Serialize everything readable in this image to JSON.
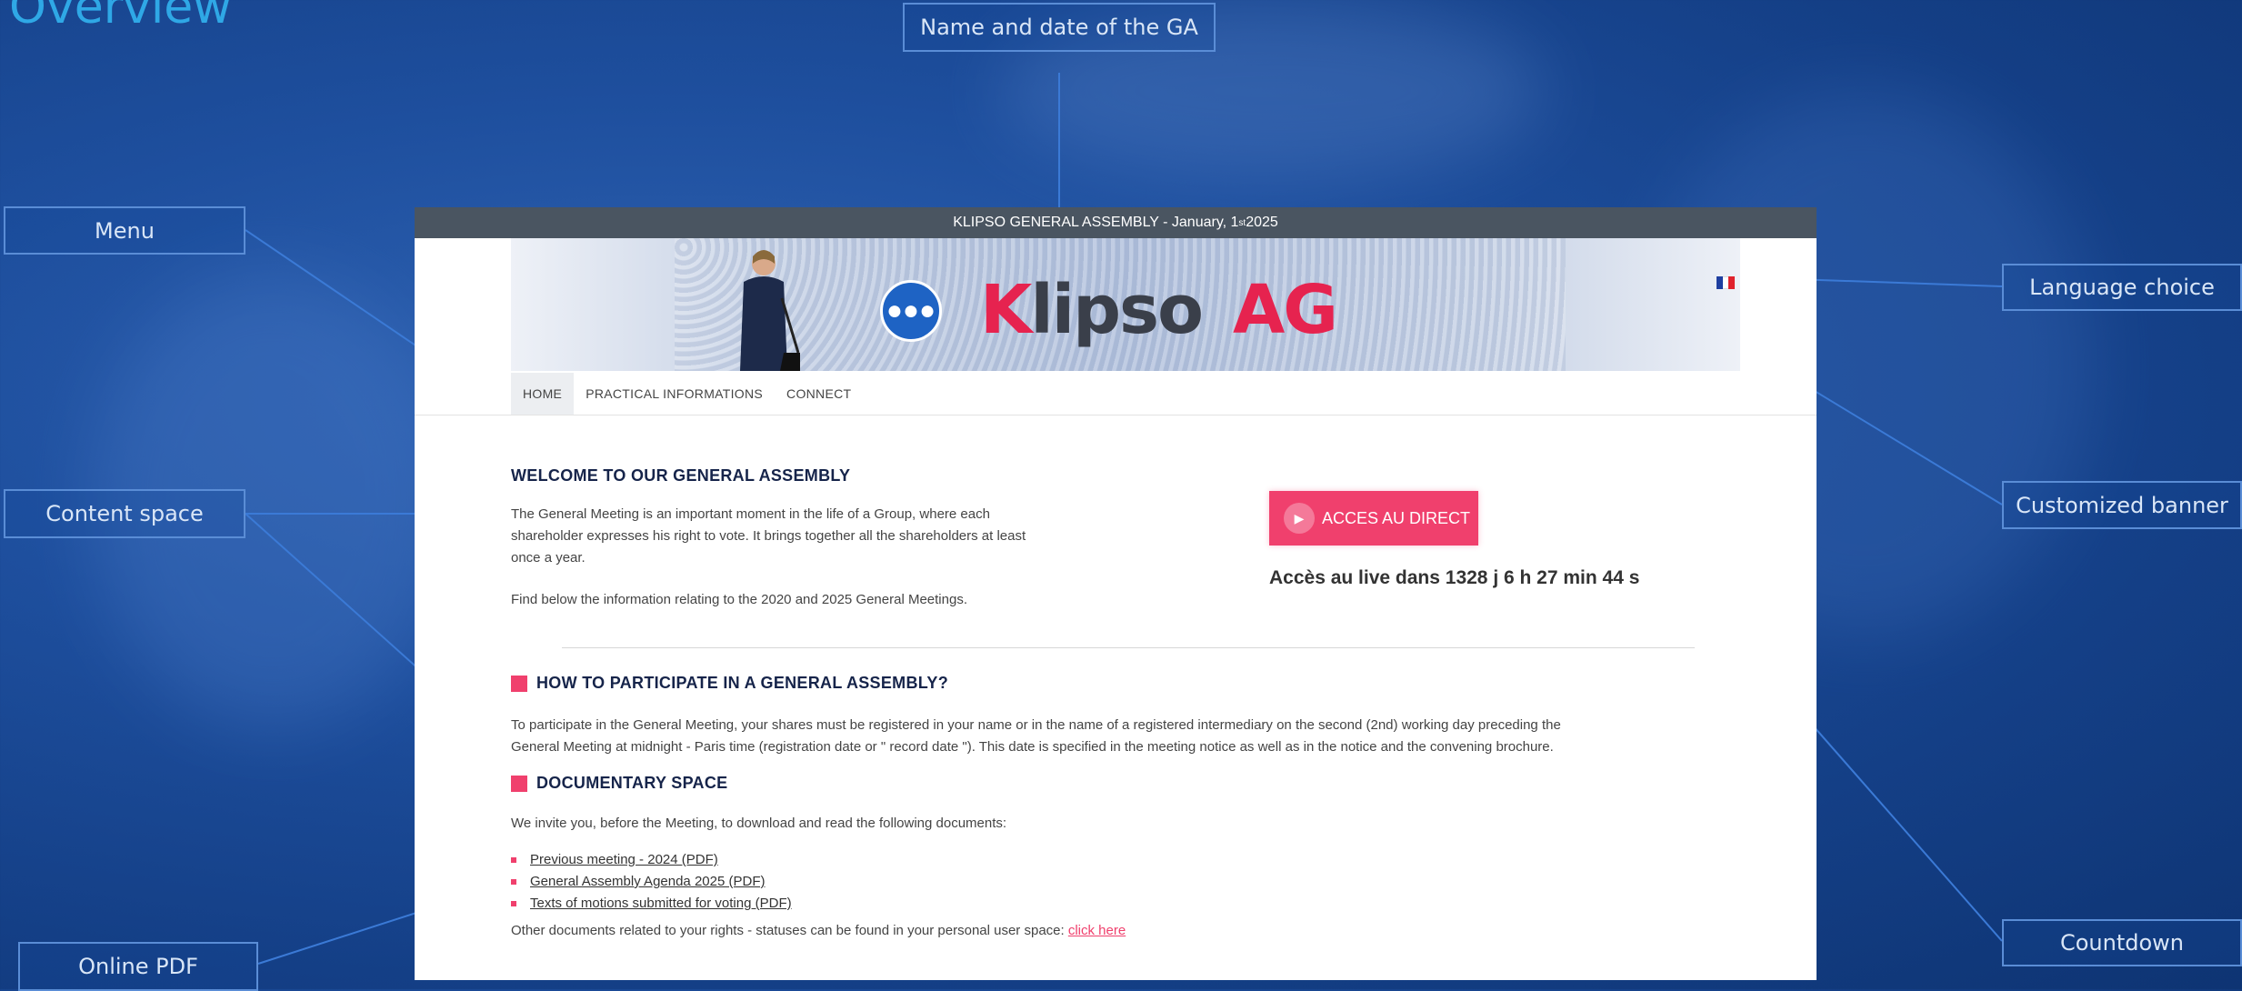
{
  "slide": {
    "title": "Overview"
  },
  "callouts": {
    "ga_name": "Name and date of the GA",
    "menu": "Menu",
    "content_space": "Content space",
    "online_pdf": "Online PDF",
    "language_choice": "Language choice",
    "customized_banner": "Customized banner",
    "countdown": "Countdown"
  },
  "mockup": {
    "topbar": {
      "title_main": "KLIPSO GENERAL ASSEMBLY - January, 1",
      "title_sup": "st",
      "title_end": " 2025"
    },
    "banner": {
      "logo_k": "K",
      "logo_rest": "lipso",
      "logo_ag": "AG",
      "logo_icon": "group-icon"
    },
    "language": {
      "flag": "france-flag-icon",
      "colors": [
        "#1f3fa0",
        "#ffffff",
        "#e0232d"
      ]
    },
    "nav": {
      "items": [
        "HOME",
        "PRACTICAL INFORMATIONS",
        "CONNECT"
      ]
    },
    "welcome": {
      "title": "WELCOME TO OUR GENERAL ASSEMBLY",
      "p1_l1": "The General Meeting is an important moment in the life of a Group, where each",
      "p1_l2": "shareholder expresses his right to vote. It brings together all the shareholders at least",
      "p1_l3": "once a year.",
      "p2": "Find below the information relating to the 2020 and 2025 General Meetings."
    },
    "live": {
      "button": "ACCES AU DIRECT",
      "countdown": "Accès au live dans 1328 j 6 h 27 min 44 s"
    },
    "participate": {
      "title": "HOW TO PARTICIPATE IN A GENERAL ASSEMBLY?",
      "l1": "To participate in the General Meeting, your shares must be registered in your name or in the name of a registered intermediary on the second (2nd) working day preceding the",
      "l2": "General Meeting at midnight - Paris time (registration date or \" record date \"). This date is specified in the meeting notice as well as in the notice and the convening brochure."
    },
    "documents": {
      "title": "DOCUMENTARY SPACE",
      "intro": "We invite you, before the Meeting, to download and read the following documents:",
      "items": [
        "Previous meeting - 2024 (PDF)",
        "General Assembly Agenda 2025 (PDF)",
        "Texts of motions submitted for voting (PDF)"
      ],
      "other": "Other documents related to your rights - statuses can be found in your personal user space: ",
      "click_here": "click here"
    }
  },
  "colors": {
    "accent": "#f0406d",
    "navy": "#16244a",
    "topbar": "#4a5561",
    "callout_border": "#5a8dd6"
  }
}
